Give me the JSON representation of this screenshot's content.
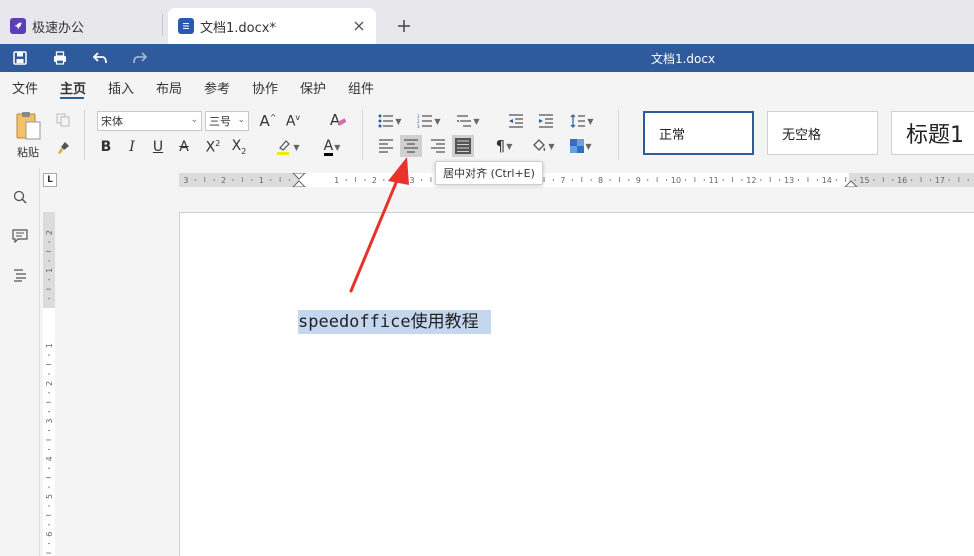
{
  "browser_tabs": [
    {
      "label": "极速办公",
      "active": false
    },
    {
      "label": "文档1.docx*",
      "active": true
    }
  ],
  "window": {
    "title": "文档1.docx"
  },
  "menu": {
    "items": [
      "文件",
      "主页",
      "插入",
      "布局",
      "参考",
      "协作",
      "保护",
      "组件"
    ],
    "active": "主页"
  },
  "ribbon": {
    "paste_label": "粘贴",
    "font_name": "宋体",
    "font_size": "三号",
    "styles": [
      "正常",
      "无空格",
      "标题1"
    ]
  },
  "tooltip": {
    "text": "居中对齐 (Ctrl+E)"
  },
  "ruler": {
    "h_labels": [
      "3",
      "2",
      "1",
      "1",
      "2",
      "3",
      "4",
      "5",
      "6",
      "7",
      "8",
      "9",
      "10",
      "11",
      "12",
      "13",
      "14",
      "15",
      "16",
      "17"
    ],
    "v_labels": [
      "2",
      "1",
      "1",
      "2",
      "3",
      "4",
      "5",
      "6"
    ]
  },
  "document": {
    "text": "speedoffice使用教程"
  },
  "colors": {
    "accent": "#2f5a9c",
    "highlight": "#c5d7ee",
    "annotation": "#e8322a"
  }
}
